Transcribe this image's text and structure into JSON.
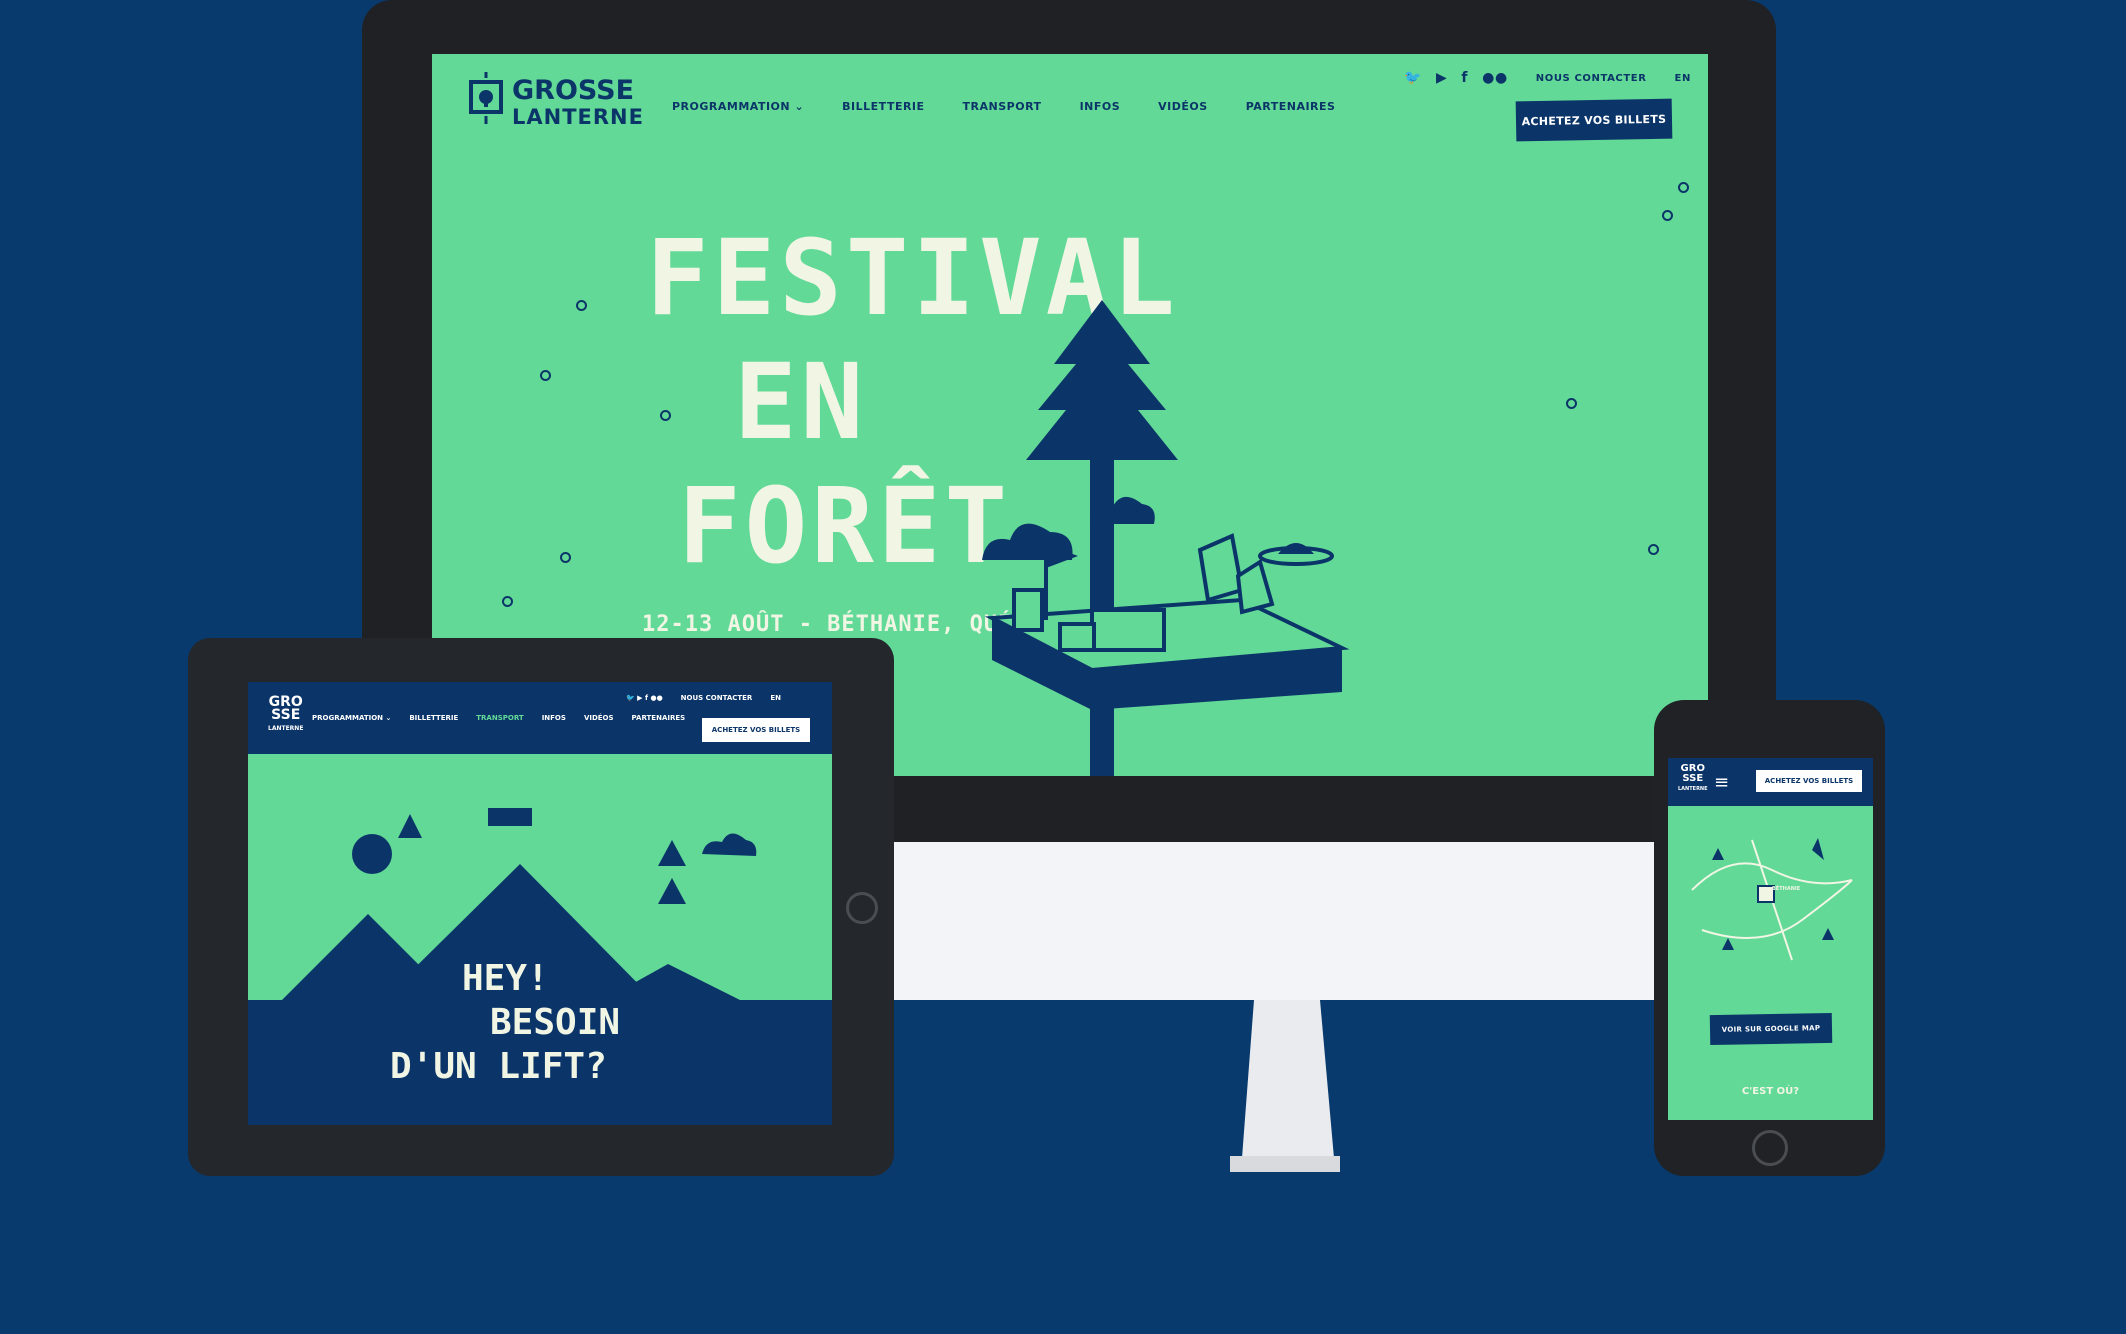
{
  "brand": {
    "line1": "GROSSE",
    "line2": "LANTERNE",
    "compact": [
      "GRO",
      "SSE"
    ],
    "compact_sub": "LANTERNE"
  },
  "desktop": {
    "nav": [
      "PROGRAMMATION",
      "BILLETTERIE",
      "TRANSPORT",
      "INFOS",
      "VIDÉOS",
      "PARTENAIRES"
    ],
    "contact": "NOUS CONTACTER",
    "lang": "EN",
    "cta": "ACHETEZ VOS BILLETS",
    "hero": {
      "line1": "FESTIVAL",
      "line2": "EN",
      "line3": "FORÊT",
      "subtitle": "12-13 AOÛT - BÉTHANIE, QUÉBEC"
    }
  },
  "tablet": {
    "nav": [
      "PROGRAMMATION",
      "BILLETTERIE",
      "TRANSPORT",
      "INFOS",
      "VIDÉOS",
      "PARTENAIRES"
    ],
    "active_nav": "TRANSPORT",
    "contact": "NOUS CONTACTER",
    "lang": "EN",
    "cta": "ACHETEZ VOS BILLETS",
    "hero": {
      "line1": "HEY!",
      "line2": "BESOIN",
      "line3": "D'UN LIFT?"
    }
  },
  "phone": {
    "cta": "ACHETEZ VOS BILLETS",
    "map_center": "BÉTHANIE",
    "map_button": "VOIR SUR GOOGLE MAP",
    "section_title": "C'EST OÙ?"
  },
  "icons": [
    "twitter-icon",
    "youtube-icon",
    "facebook-icon",
    "flickr-icon",
    "menu-icon",
    "chevron-down-icon",
    "lantern-logo-icon"
  ],
  "colors": {
    "background": "#083a6e",
    "green": "#62d996",
    "navy": "#0b3569",
    "cream": "#f1f5e4",
    "device": "#1f2125"
  }
}
